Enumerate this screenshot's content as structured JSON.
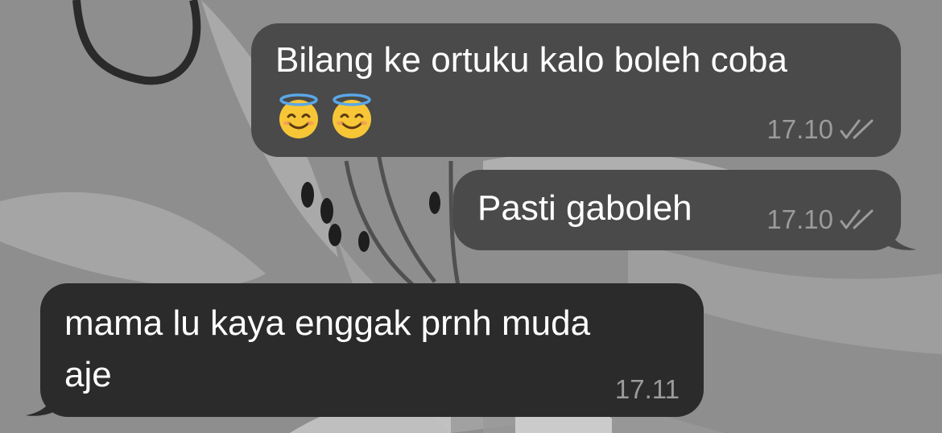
{
  "chat": {
    "messages": [
      {
        "direction": "outgoing",
        "text_line1": "Bilang ke ortuku kalo boleh coba",
        "emojis": [
          "smiling-face-with-halo-icon",
          "smiling-face-with-halo-icon"
        ],
        "time": "17.10",
        "status_icon": "double-check-icon"
      },
      {
        "direction": "outgoing",
        "text": "Pasti gaboleh",
        "time": "17.10",
        "status_icon": "double-check-icon"
      },
      {
        "direction": "incoming",
        "text_line1": "mama lu kaya enggak prnh muda",
        "text_line2": "aje",
        "time": "17.11"
      }
    ]
  },
  "colors": {
    "wallpaper": "#8c8c8c",
    "outgoing_bubble": "#4a4a4a",
    "incoming_bubble": "#2b2b2b",
    "message_text": "#ffffff",
    "meta_text": "#9b9b9b"
  }
}
